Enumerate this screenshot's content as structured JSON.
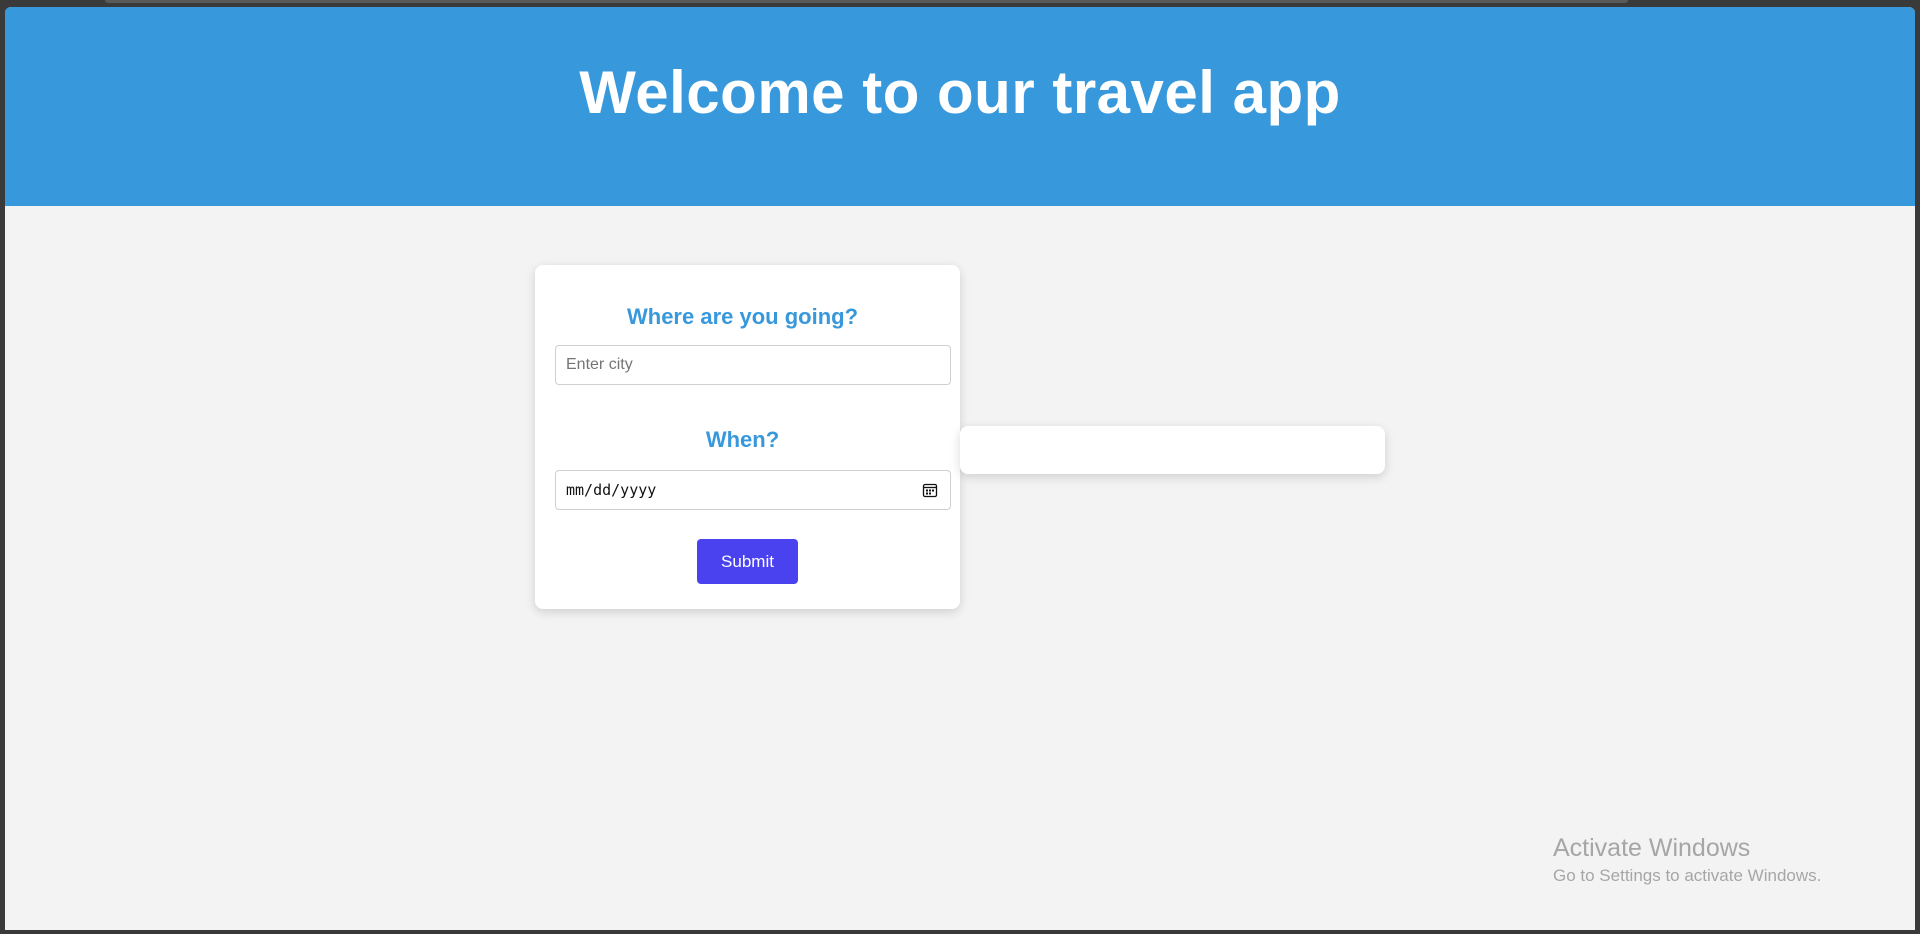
{
  "header": {
    "title": "Welcome to our travel app"
  },
  "form": {
    "destination_heading": "Where are you going?",
    "city_placeholder": "Enter city",
    "date_heading": "When?",
    "date_placeholder": "mm/dd/yyyy",
    "submit_label": "Submit"
  },
  "watermark": {
    "title": "Activate Windows",
    "subtitle": "Go to Settings to activate Windows."
  },
  "colors": {
    "header_bg": "#3898dc",
    "page_bg": "#f3f3f3",
    "heading_accent": "#3898dc",
    "submit_bg": "#4a42ee"
  },
  "icons": {
    "date_picker": "calendar-icon"
  }
}
